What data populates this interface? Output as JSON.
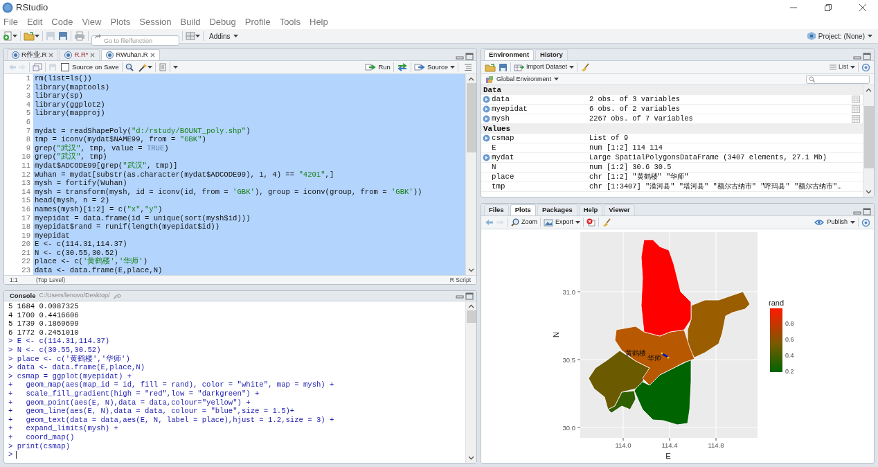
{
  "window": {
    "title": "RStudio"
  },
  "menu": [
    "File",
    "Edit",
    "Code",
    "View",
    "Plots",
    "Session",
    "Build",
    "Debug",
    "Profile",
    "Tools",
    "Help"
  ],
  "toolbar": {
    "goto_placeholder": "Go to file/function",
    "addins": "Addins",
    "project": "Project: (None)"
  },
  "editor": {
    "tabs": [
      {
        "label": "R作业.R",
        "selected": false,
        "modified": false
      },
      {
        "label": "R.R*",
        "selected": false,
        "modified": true
      },
      {
        "label": "RWuhan.R",
        "selected": true,
        "modified": false
      }
    ],
    "source_on_save": {
      "label": "Source on Save",
      "checked": false
    },
    "run": "Run",
    "source": "Source",
    "lines": [
      {
        "number": "1",
        "text": "rm(list=ls())",
        "selected": true
      },
      {
        "number": "2",
        "text": "library(maptools)",
        "selected": true
      },
      {
        "number": "3",
        "text": "library(sp)",
        "selected": true
      },
      {
        "number": "4",
        "text": "library(ggplot2)",
        "selected": true
      },
      {
        "number": "5",
        "text": "library(mapproj)",
        "selected": true
      },
      {
        "number": "6",
        "selected": true
      },
      {
        "number": "7",
        "text": "mydat = readShapePoly(\"d:/rstudy/BOUNT_poly.shp\")",
        "selected": true
      },
      {
        "number": "8",
        "text": "tmp = iconv(mydat$NAME99, from = \"GBK\")",
        "selected": true
      },
      {
        "number": "9",
        "text": "grep(\"武汉\", tmp, value = TRUE)",
        "selected": true
      },
      {
        "number": "10",
        "text": "grep(\"武汉\", tmp)",
        "selected": true
      },
      {
        "number": "11",
        "text": "mydat$ADCODE99[grep(\"武汉\", tmp)]",
        "selected": true
      },
      {
        "number": "12",
        "text": "Wuhan = mydat[substr(as.character(mydat$ADCODE99), 1, 4) == \"4201\",]",
        "selected": true
      },
      {
        "number": "13",
        "text": "mysh = fortify(Wuhan)",
        "selected": true
      },
      {
        "number": "14",
        "text": "mysh = transform(mysh, id = iconv(id, from = 'GBK'), group = iconv(group, from = 'GBK'))",
        "selected": true
      },
      {
        "number": "15",
        "text": "head(mysh, n = 2)",
        "selected": true
      },
      {
        "number": "16",
        "text": "names(mysh)[1:2] = c(\"x\",\"y\")",
        "selected": true
      },
      {
        "number": "17",
        "text": "myepidat = data.frame(id = unique(sort(mysh$id)))",
        "selected": true
      },
      {
        "number": "18",
        "text": "myepidat$rand = runif(length(myepidat$id))",
        "selected": true
      },
      {
        "number": "19",
        "text": "myepidat",
        "selected": true
      },
      {
        "number": "20",
        "text": "E <- c(114.31,114.37)",
        "selected": true
      },
      {
        "number": "21",
        "text": "N <- c(30.55,30.52)",
        "selected": true
      },
      {
        "number": "22",
        "text": "place <- c('黄鹤楼','华师')",
        "selected": true
      },
      {
        "number": "23",
        "text": "data <- data.frame(E,place,N)",
        "selected": true
      }
    ],
    "status": {
      "position": "1:1",
      "scope": "(Top Level)",
      "type": "R Script"
    }
  },
  "console": {
    "title": "Console",
    "path": "C:/Users/lenovo/Desktop/",
    "lines": [
      {
        "kind": "output",
        "text": "5 1684 0.0087325"
      },
      {
        "kind": "output",
        "text": "4 1700 0.4416606"
      },
      {
        "kind": "output",
        "text": "5 1739 0.1869699"
      },
      {
        "kind": "output",
        "text": "6 1772 0.2451010"
      },
      {
        "kind": "input",
        "text": "> E <- c(114.31,114.37)"
      },
      {
        "kind": "input",
        "text": "> N <- c(30.55,30.52)"
      },
      {
        "kind": "input",
        "text": "> place <- c('黄鹤楼','华师')"
      },
      {
        "kind": "input",
        "text": "> data <- data.frame(E,place,N)"
      },
      {
        "kind": "input",
        "text": "> csmap = ggplot(myepidat) +"
      },
      {
        "kind": "input",
        "text": "+   geom_map(aes(map_id = id, fill = rand), color = \"white\", map = mysh) +"
      },
      {
        "kind": "input",
        "text": "+   scale_fill_gradient(high = \"red\",low = \"darkgreen\") +"
      },
      {
        "kind": "input",
        "text": "+   geom_point(aes(E, N),data = data,colour=\"yellow\") +"
      },
      {
        "kind": "input",
        "text": "+   geom_line(aes(E, N),data = data, colour = \"blue\",size = 1.5)+"
      },
      {
        "kind": "input",
        "text": "+   geom_text(data = data,aes(E, N, label = place),hjust = 1.2,size = 3) +"
      },
      {
        "kind": "input",
        "text": "+   expand_limits(mysh) +"
      },
      {
        "kind": "input",
        "text": "+   coord_map()"
      },
      {
        "kind": "input",
        "text": "> print(csmap)"
      },
      {
        "kind": "prompt",
        "text": ">"
      }
    ]
  },
  "environment": {
    "tabs": [
      {
        "label": "Environment",
        "selected": true
      },
      {
        "label": "History",
        "selected": false
      }
    ],
    "import": "Import Dataset",
    "view": "List",
    "scope": "Global Environment",
    "sections": [
      {
        "title": "Data",
        "rows": [
          {
            "name": "data",
            "value": "2 obs. of 3 variables",
            "expandable": true,
            "table": true
          },
          {
            "name": "myepidat",
            "value": "6 obs. of 2 variables",
            "expandable": true,
            "table": true
          },
          {
            "name": "mysh",
            "value": "2267 obs. of 7 variables",
            "expandable": true,
            "table": true
          }
        ]
      },
      {
        "title": "Values",
        "rows": [
          {
            "name": "csmap",
            "value": "List of 9",
            "expandable": true,
            "table": false
          },
          {
            "name": "E",
            "value": "num [1:2] 114 114",
            "expandable": false,
            "table": false
          },
          {
            "name": "mydat",
            "value": "Large SpatialPolygonsDataFrame (3407 elements, 27.1 Mb)",
            "expandable": true,
            "table": false
          },
          {
            "name": "N",
            "value": "num [1:2] 30.6 30.5",
            "expandable": false,
            "table": false
          },
          {
            "name": "place",
            "value": "chr [1:2] \"黄鹤楼\" \"华师\"",
            "expandable": false,
            "table": false
          },
          {
            "name": "tmp",
            "value": "chr [1:3407] \"漠河县\" \"塔河县\" \"额尔古纳市\" \"呼玛县\" \"额尔古纳市\"…",
            "expandable": false,
            "table": false
          }
        ]
      }
    ]
  },
  "plots": {
    "tabs": [
      {
        "label": "Files",
        "selected": false
      },
      {
        "label": "Plots",
        "selected": true
      },
      {
        "label": "Packages",
        "selected": false
      },
      {
        "label": "Help",
        "selected": false
      },
      {
        "label": "Viewer",
        "selected": false
      }
    ],
    "zoom": "Zoom",
    "export": "Export",
    "publish": "Publish",
    "plot": {
      "yticks": [
        "31.0",
        "30.5",
        "30.0"
      ],
      "xticks": [
        "114.0",
        "114.4",
        "114.8"
      ],
      "xlabel": "E",
      "ylabel": "N",
      "legend_title": "rand",
      "legend_labels": [
        "0.8",
        "0.6",
        "0.4",
        "0.2"
      ],
      "map_labels": [
        "黄鹤楼",
        "华师"
      ]
    }
  }
}
